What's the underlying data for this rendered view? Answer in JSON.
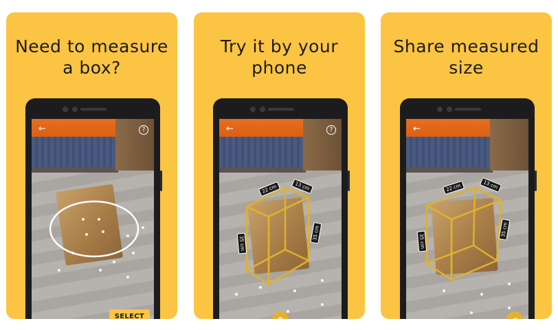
{
  "cards": [
    {
      "title_line1": "Need to measure",
      "title_line2": "a box?"
    },
    {
      "title_line1": "Try it by your",
      "title_line2": "phone"
    },
    {
      "title_line1": "Share measured",
      "title_line2": "size"
    }
  ],
  "ui": {
    "back_icon": "←",
    "help_icon": "?",
    "select_label": "SELECT",
    "camera_icon": "◉",
    "share_icon": "<"
  },
  "measurements": {
    "width": "22 cm",
    "depth": "13 cm",
    "height": "35 cm",
    "side": "35 cm"
  },
  "colors": {
    "card_background": "#fcc443",
    "outline": "#e0b12d",
    "button": "#fcc443"
  }
}
